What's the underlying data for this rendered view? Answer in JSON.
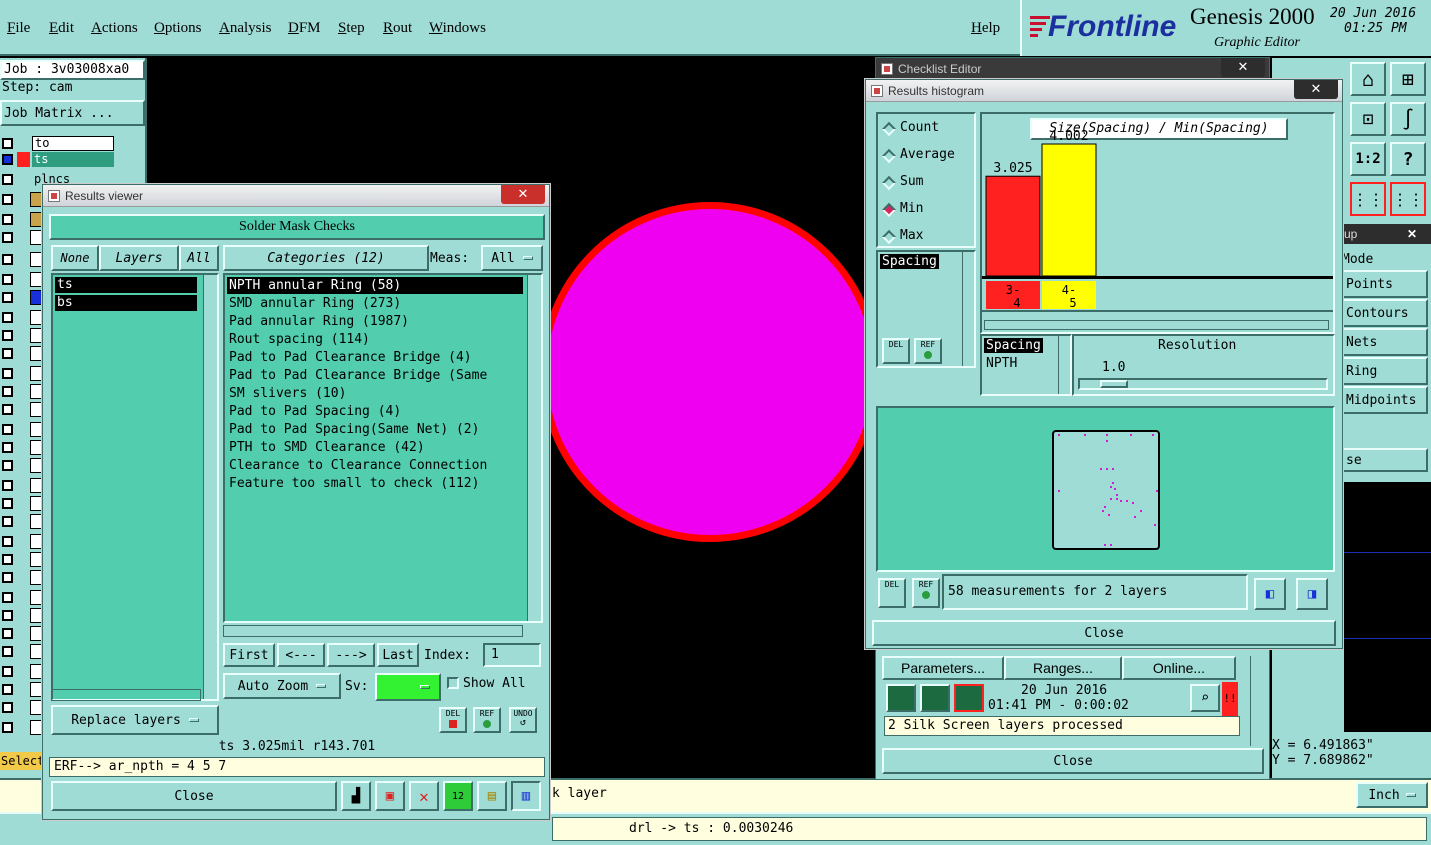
{
  "menu": {
    "items": [
      "File",
      "Edit",
      "Actions",
      "Options",
      "Analysis",
      "DFM",
      "Step",
      "Rout",
      "Windows"
    ],
    "help": "Help"
  },
  "brand": {
    "logo": "Frontline",
    "product": "Genesis 2000",
    "subtitle": "Graphic Editor",
    "date": "20 Jun 2016",
    "time": "01:25 PM"
  },
  "left_panel": {
    "job": "Job : 3v03008xa0",
    "step": "Step: cam",
    "job_matrix": "Job Matrix ...",
    "layers": [
      "to",
      "ts",
      "plncs"
    ],
    "select_label": "Select"
  },
  "results_viewer": {
    "title": "Results viewer",
    "header": "Solder Mask Checks",
    "none": "None",
    "layers_btn": "Layers",
    "all_btn": "All",
    "categories_btn": "Categories (12)",
    "meas_label": "Meas:",
    "meas_value": "All",
    "layer_items": [
      "ts",
      "bs"
    ],
    "categories": [
      "NPTH annular Ring (58)",
      "SMD annular Ring (273)",
      "Pad annular Ring (1987)",
      "Rout spacing (114)",
      "Pad to Pad Clearance Bridge (4)",
      "Pad to Pad Clearance Bridge (Same",
      "SM slivers (10)",
      "Pad to Pad Spacing (4)",
      "Pad to Pad Spacing(Same Net) (2)",
      "PTH to SMD Clearance (42)",
      "Clearance to Clearance Connection",
      "Feature too small to check (112)"
    ],
    "first": "First",
    "prev": "<---",
    "next": "--->",
    "last": "Last",
    "index_label": "Index:",
    "index_value": "1",
    "auto_zoom": "Auto Zoom",
    "sv_label": "Sv:",
    "show_all": "Show All",
    "replace_layers": "Replace layers",
    "del": "DEL",
    "ref": "REF",
    "undo": "UNDO",
    "status": "ts 3.025mil  r143.701",
    "erf": "ERF--> ar_npth = 4 5 7",
    "close": "Close"
  },
  "checklist_editor": {
    "title": "Checklist Editor",
    "parameters": "Parameters...",
    "ranges": "Ranges...",
    "online": "Online...",
    "date": "20 Jun 2016",
    "time": "01:41 PM - 0:00:02",
    "message": "2 Silk Screen layers processed",
    "close": "Close"
  },
  "histogram": {
    "title": "Results histogram",
    "options": [
      "Count",
      "Average",
      "Sum",
      "Min",
      "Max"
    ],
    "selected_option": "Min",
    "chart_title": "Size(Spacing) / Min(Spacing)",
    "list_items": [
      "Spacing"
    ],
    "spacing_label": "Spacing",
    "npth_label": "NPTH",
    "resolution_label": "Resolution",
    "resolution_value": "1.0",
    "measurements": "58 measurements for 2 layers",
    "del": "DEL",
    "ref": "REF",
    "close": "Close"
  },
  "chart_data": {
    "type": "bar",
    "title": "Size(Spacing) / Min(Spacing)",
    "categories": [
      "3-4",
      "4-5"
    ],
    "values": [
      3.025,
      4.002
    ],
    "colors": [
      "#ff2020",
      "#ffff00"
    ]
  },
  "right_toolbar": {
    "mode": "Mode",
    "items": [
      "Points",
      "Contours",
      "Nets",
      "Ring",
      "Midpoints"
    ],
    "close_frag": "se",
    "up_frag": "up",
    "x_coord": "X = 6.491863\"",
    "y_coord": "Y = 7.689862\"",
    "units": "Inch"
  },
  "status_bar": {
    "layer_msg": "k layer",
    "readout": "drl -> ts : 0.0030246"
  },
  "colors": {
    "teal": "#9fdcd6",
    "green": "#52cdae",
    "pad_fill": "#f000f0",
    "pad_ring": "#ff0000"
  }
}
